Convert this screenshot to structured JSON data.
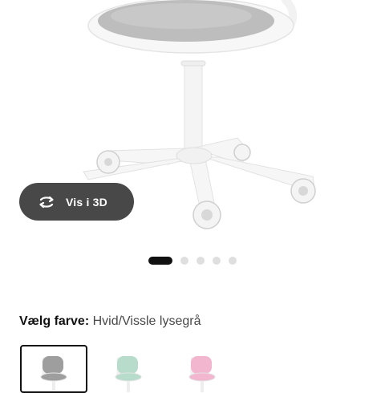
{
  "product_image": {
    "alt": "Ørfjäll chair",
    "seat_color": "#bdbdbd",
    "frame_color": "#f5f5f5"
  },
  "view_3d": {
    "label": "Vis i 3D",
    "icon": "rotate-3d-icon"
  },
  "carousel": {
    "slide_count": 5,
    "active_index": 0
  },
  "color_selector": {
    "prefix": "Vælg farve:",
    "value": "Hvid/Vissle lysegrå",
    "swatches": [
      {
        "color": "#9e9e9e",
        "selected": true
      },
      {
        "color": "#b8dccb",
        "selected": false
      },
      {
        "color": "#f2b6cf",
        "selected": false
      }
    ]
  }
}
